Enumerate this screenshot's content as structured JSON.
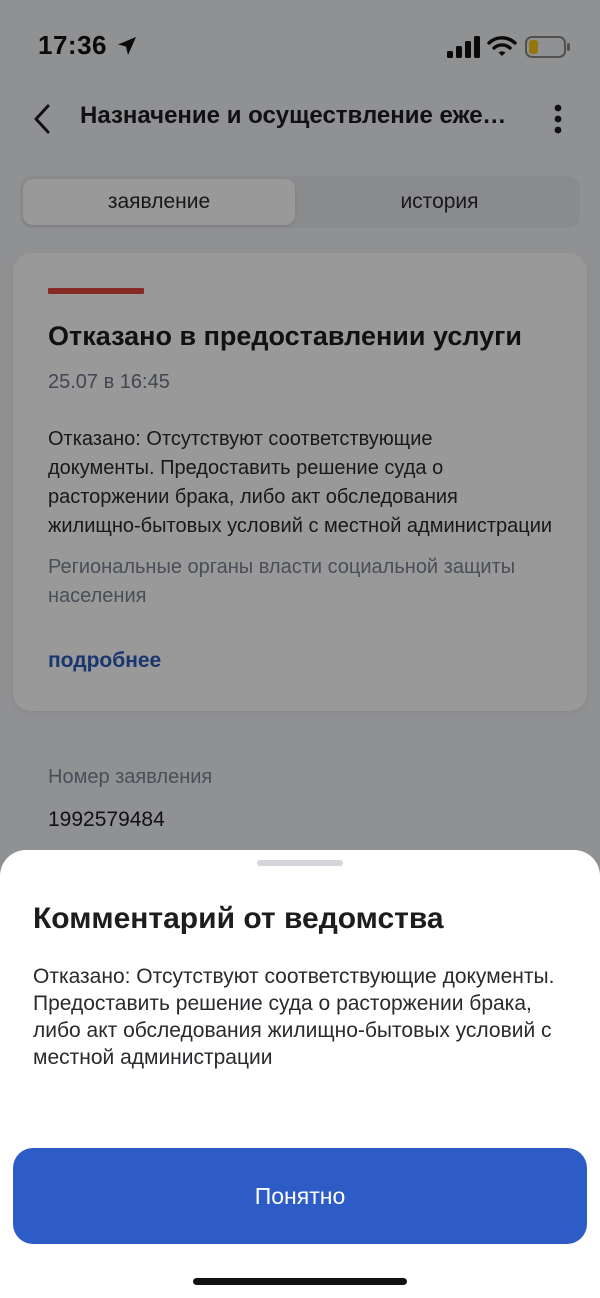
{
  "status_bar": {
    "time": "17:36",
    "icons": [
      "location-arrow-icon",
      "cellular-signal-icon",
      "wifi-icon",
      "battery-low-icon"
    ]
  },
  "header": {
    "title": "Назначение и осуществление ежемесячной выплаты",
    "icons": [
      "chevron-left-icon",
      "more-vertical-icon"
    ]
  },
  "tabs": [
    {
      "label": "заявление",
      "active": true
    },
    {
      "label": "история",
      "active": false
    }
  ],
  "status_card": {
    "title": "Отказано в предоставлении услуги",
    "date": "25.07 в 16:45",
    "text_lines": [
      "Отказано: Отсутствуют соответствующие",
      "документы. Предоставить решение суда о",
      "расторжении брака, либо акт обследования",
      "жилищно-бытовых условий с местной администрации"
    ],
    "organization": "Региональные органы власти социальной защиты населения",
    "more_link": "подробнее",
    "accent_color": "#e0463b"
  },
  "application": {
    "number_label": "Номер заявления",
    "number_value": "1992579484"
  },
  "sheet": {
    "title": "Комментарий от ведомства",
    "text": "Отказано: Отсутствуют соответствующие документы. Предоставить решение суда о расторжении брака, либо акт обследования жилищно-бытовых условий с местной администрации",
    "button_label": "Понятно",
    "button_color": "#2e5cc7"
  }
}
